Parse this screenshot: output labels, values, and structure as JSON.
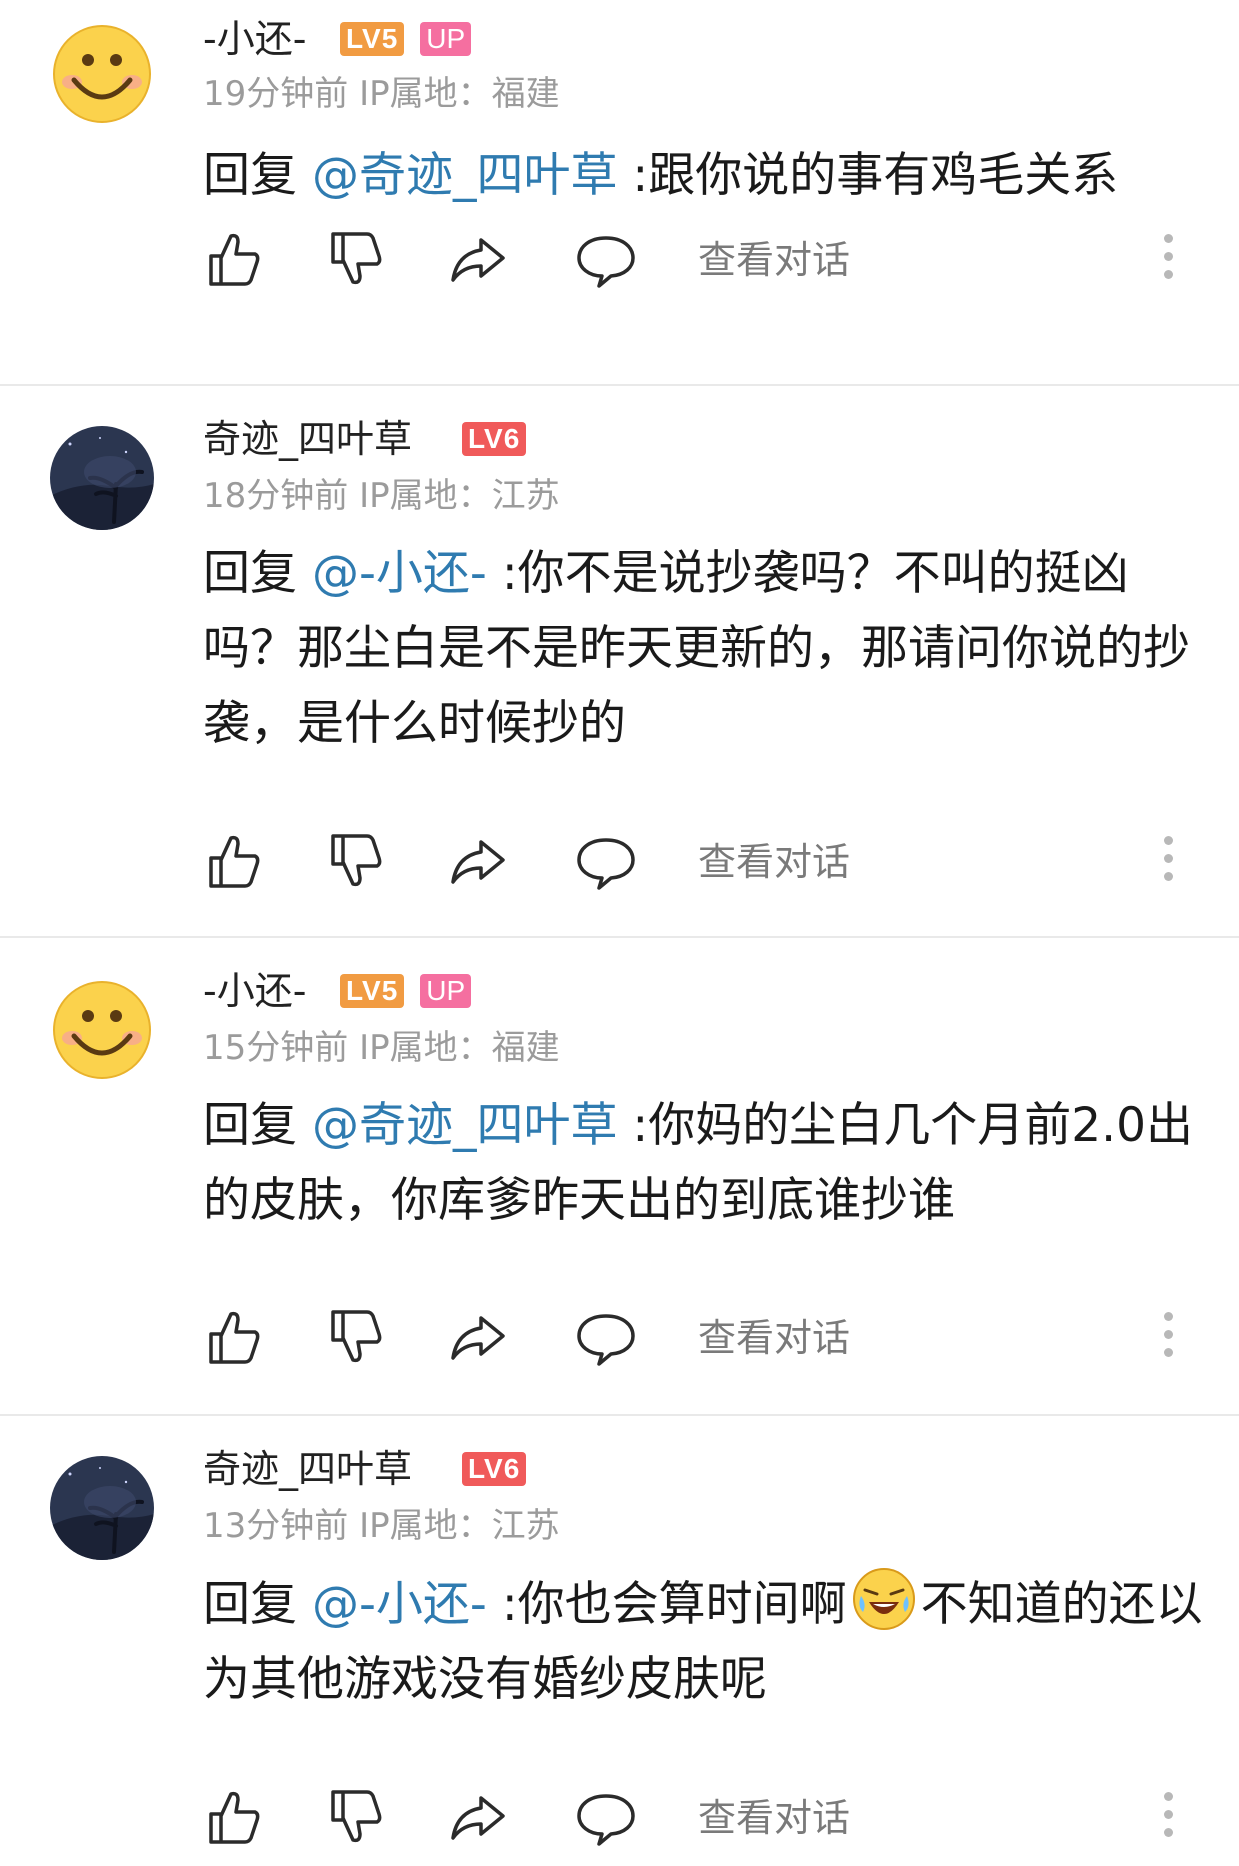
{
  "comments": [
    {
      "username": "-小还-",
      "level": "LV5",
      "up_badge": "UP",
      "time": "19分钟前",
      "ip": "IP属地：福建",
      "reply_prefix": "回复",
      "mention": "@奇迹_四叶草",
      "text": " :跟你说的事有鸡毛关系",
      "view_conversation": "查看对话"
    },
    {
      "username": "奇迹_四叶草",
      "level": "LV6",
      "time": "18分钟前",
      "ip": "IP属地：江苏",
      "reply_prefix": "回复",
      "mention": "@-小还-",
      "text": " :你不是说抄袭吗？不叫的挺凶吗？那尘白是不是昨天更新的，那请问你说的抄袭，是什么时候抄的",
      "view_conversation": "查看对话"
    },
    {
      "username": "-小还-",
      "level": "LV5",
      "up_badge": "UP",
      "time": "15分钟前",
      "ip": "IP属地：福建",
      "reply_prefix": "回复",
      "mention": "@奇迹_四叶草",
      "text": " :你妈的尘白几个月前2.0出的皮肤，你库爹昨天出的到底谁抄谁",
      "view_conversation": "查看对话"
    },
    {
      "username": "奇迹_四叶草",
      "level": "LV6",
      "time": "13分钟前",
      "ip": "IP属地：江苏",
      "reply_prefix": "回复",
      "mention": "@-小还-",
      "text": " :你也会算时间啊",
      "emoji": "laughing-crying-emoji",
      "text_after": "不知道的还以为其他游戏没有婚纱皮肤呢",
      "view_conversation": "查看对话"
    }
  ],
  "colors": {
    "mention": "#2f7bb0",
    "lv5": "#f19b42",
    "lv6": "#f05a5a",
    "up": "#f56fa0",
    "meta": "#9b9b9b"
  },
  "icons": [
    "like-icon",
    "dislike-icon",
    "share-icon",
    "reply-icon",
    "more-icon"
  ]
}
